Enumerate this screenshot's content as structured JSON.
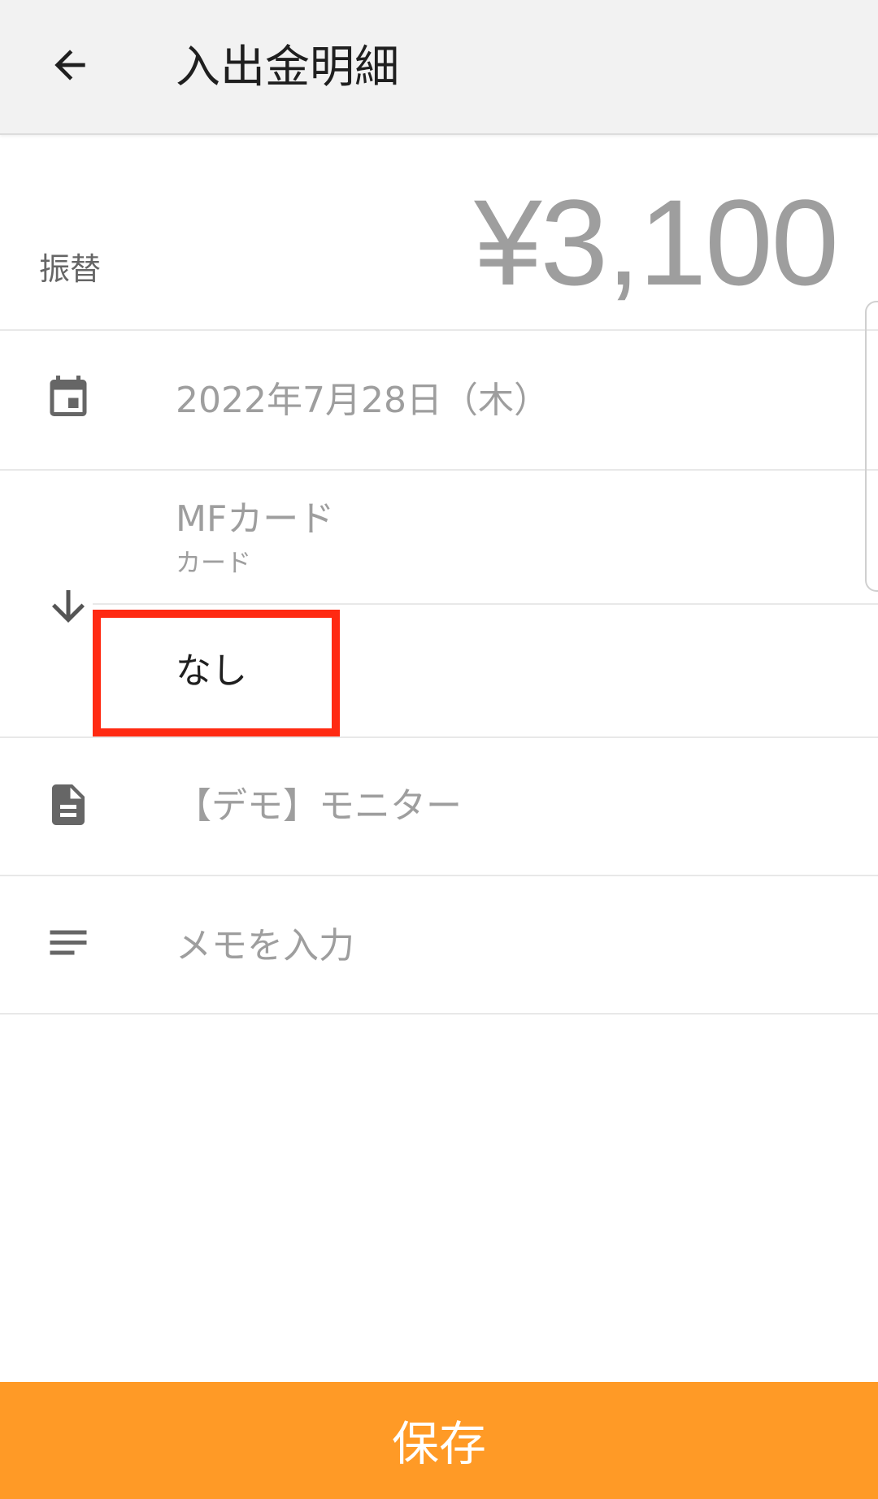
{
  "header": {
    "title": "入出金明細",
    "back_icon": "arrow-back-icon"
  },
  "summary": {
    "type_label": "振替",
    "amount": "¥3,100"
  },
  "date_row": {
    "icon": "calendar-icon",
    "value": "2022年7月28日（木）"
  },
  "transfer": {
    "icon": "arrow-down-icon",
    "from_account": "MFカード",
    "from_account_type": "カード",
    "to_account": "なし"
  },
  "content_row": {
    "icon": "document-icon",
    "value": "【デモ】モニター"
  },
  "memo_row": {
    "icon": "notes-icon",
    "placeholder": "メモを入力"
  },
  "footer": {
    "save_label": "保存",
    "accent_color": "#ff9a26",
    "highlight_color": "#ff2a12"
  }
}
